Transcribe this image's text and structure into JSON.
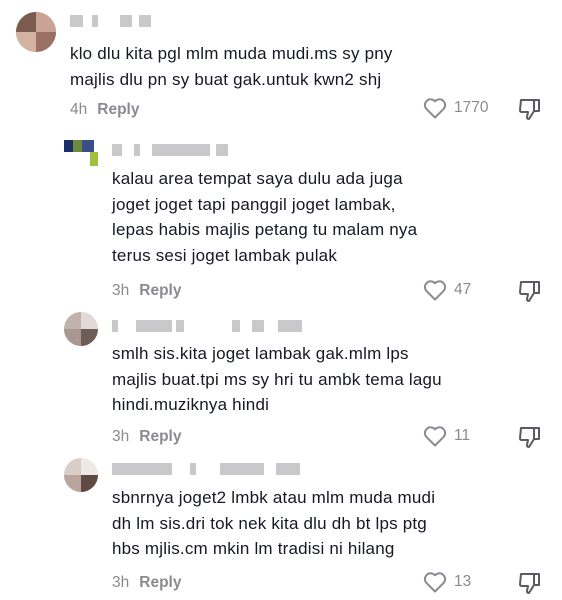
{
  "comments": [
    {
      "text": "klo dlu kita pgl mlm muda mudi.ms sy pny\nmajlis dlu pn sy buat gak.untuk kwn2 shj",
      "time": "4h",
      "reply_label": "Reply",
      "likes": "1770"
    },
    {
      "text": "kalau area tempat saya dulu ada juga\njoget joget tapi panggil joget lambak,\nlepas habis majlis petang tu malam nya\nterus sesi joget lambak pulak",
      "time": "3h",
      "reply_label": "Reply",
      "likes": "47"
    },
    {
      "text": "smlh sis.kita joget lambak gak.mlm lps\nmajlis buat.tpi ms sy hri tu ambk tema lagu\nhindi.muziknya hindi",
      "time": "3h",
      "reply_label": "Reply",
      "likes": "11"
    },
    {
      "text": "sbnrnya joget2 lmbk atau mlm muda mudi\ndh lm sis.dri tok nek kita dlu dh bt lps ptg\nhbs mjlis.cm mkin lm tradisi ni hilang",
      "time": "3h",
      "reply_label": "Reply",
      "likes": "13"
    }
  ],
  "icons": {
    "like": "heart-outline-icon",
    "dislike": "thumbs-down-icon"
  },
  "colors": {
    "text": "#161823",
    "muted": "#8a8b91",
    "redacted": "#c9c9cc"
  }
}
